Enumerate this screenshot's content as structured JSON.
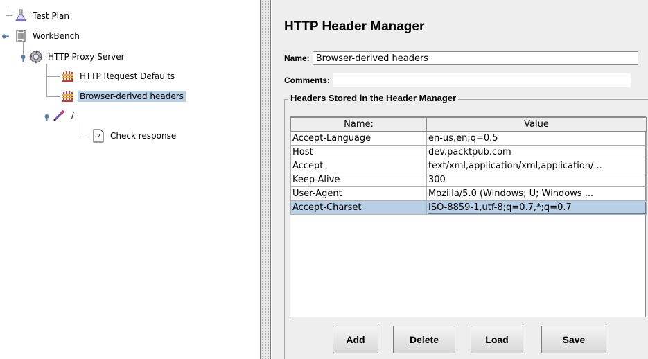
{
  "tree": {
    "nodes": [
      {
        "label": "Test Plan",
        "icon": "flask-icon"
      },
      {
        "label": "WorkBench",
        "icon": "clipboard-icon"
      },
      {
        "label": "HTTP Proxy Server",
        "icon": "gear-icon"
      },
      {
        "label": "HTTP Request Defaults",
        "icon": "tool-icon"
      },
      {
        "label": "Browser-derived headers",
        "icon": "tool-icon"
      },
      {
        "label": "/",
        "icon": "pipette-icon"
      },
      {
        "label": "Check response",
        "icon": "assertion-icon"
      }
    ],
    "selected": "Browser-derived headers"
  },
  "panel": {
    "title": "HTTP Header Manager",
    "name_label": "Name:",
    "name_value": "Browser-derived headers",
    "comments_label": "Comments:",
    "comments_value": "",
    "group_title": "Headers Stored in the Header Manager"
  },
  "table": {
    "columns": [
      "Name:",
      "Value"
    ],
    "rows": [
      [
        "Accept-Language",
        "en-us,en;q=0.5"
      ],
      [
        "Host",
        "dev.packtpub.com"
      ],
      [
        "Accept",
        "text/xml,application/xml,application/..."
      ],
      [
        "Keep-Alive",
        "300"
      ],
      [
        "User-Agent",
        "Mozilla/5.0 (Windows; U; Windows ..."
      ],
      [
        "Accept-Charset",
        "ISO-8859-1,utf-8;q=0.7,*;q=0.7"
      ]
    ],
    "selected_row": 5
  },
  "buttons": {
    "add": {
      "mnemonic": "A",
      "rest": "dd"
    },
    "delete": {
      "mnemonic": "D",
      "rest": "elete"
    },
    "load": {
      "mnemonic": "L",
      "rest": "oad"
    },
    "save": {
      "mnemonic": "S",
      "rest": "ave"
    }
  }
}
